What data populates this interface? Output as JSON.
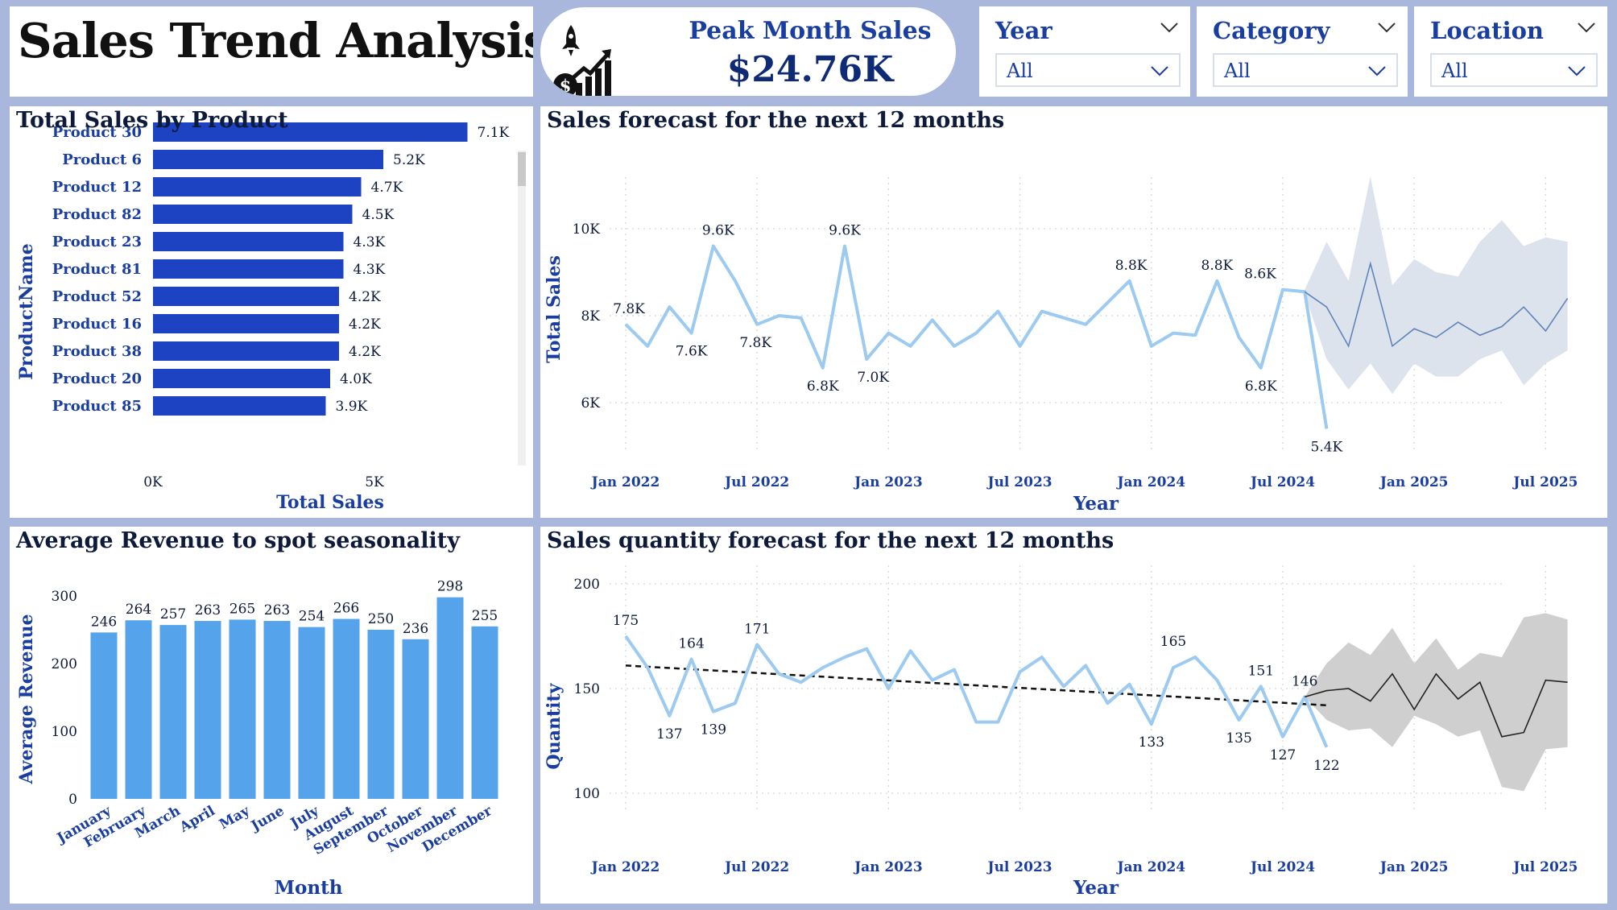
{
  "header": {
    "title": "Sales Trend Analysis",
    "kpi": {
      "label": "Peak Month Sales",
      "value": "$24.76K",
      "icon": "rocket-growth-chart-icon"
    }
  },
  "slicers": [
    {
      "title": "Year",
      "value": "All"
    },
    {
      "title": "Category",
      "value": "All"
    },
    {
      "title": "Location",
      "value": "All"
    }
  ],
  "colors": {
    "dark_bar": "#1d43c2",
    "light_bar": "#55a3ea",
    "line": "#9ccaf0",
    "forecast_band": "#dde3ec",
    "quantity_band": "#cfcfcf",
    "title_blue": "#1a3ea0",
    "background": "#a9b7dc"
  },
  "panels": {
    "products": {
      "title": "Total Sales by Product"
    },
    "forecast": {
      "title": "Sales forecast for the next 12 months"
    },
    "seasonal": {
      "title": "Average Revenue to spot seasonality"
    },
    "quantity": {
      "title": "Sales quantity forecast for the next 12 months"
    }
  },
  "chart_data": [
    {
      "id": "products",
      "type": "bar",
      "orientation": "horizontal",
      "xlabel": "Total Sales",
      "ylabel": "ProductName",
      "xlim": [
        0,
        7500
      ],
      "x_ticks": [
        "0K",
        "5K"
      ],
      "categories": [
        "Product 30",
        "Product 6",
        "Product 12",
        "Product 82",
        "Product 23",
        "Product 81",
        "Product 52",
        "Product 16",
        "Product 38",
        "Product 20",
        "Product 85"
      ],
      "values": [
        7100,
        5200,
        4700,
        4500,
        4300,
        4300,
        4200,
        4200,
        4200,
        4000,
        3900
      ],
      "labels": [
        "7.1K",
        "5.2K",
        "4.7K",
        "4.5K",
        "4.3K",
        "4.3K",
        "4.2K",
        "4.2K",
        "4.2K",
        "4.0K",
        "3.9K"
      ]
    },
    {
      "id": "forecast",
      "type": "line",
      "xlabel": "Year",
      "ylabel": "Total Sales",
      "ylim": [
        5000,
        11000
      ],
      "y_ticks": [
        {
          "value": 6000,
          "label": "6K"
        },
        {
          "value": 8000,
          "label": "8K"
        },
        {
          "value": 10000,
          "label": "10K"
        }
      ],
      "x_ticks": [
        "Jan 2022",
        "Jul 2022",
        "Jan 2023",
        "Jul 2023",
        "Jan 2024",
        "Jul 2024",
        "Jan 2025",
        "Jul 2025"
      ],
      "x_start": "Jan 2022",
      "series": [
        {
          "values": [
            7800,
            7300,
            8200,
            7600,
            9600,
            8800,
            7800,
            8000,
            7950,
            6800,
            9600,
            7000,
            7600,
            7300,
            7900,
            7300,
            7600,
            8100,
            7300,
            8100,
            7950,
            7800,
            8300,
            8800,
            7300,
            7600,
            7550,
            8800,
            7500,
            6800,
            8600,
            8550,
            5400
          ]
        },
        {
          "values": [
            8200,
            7300,
            9200,
            7300,
            7700,
            7500,
            7850,
            7550,
            7750,
            8200,
            7650,
            8400
          ]
        }
      ],
      "forecast_start": "Jul 2024",
      "forecast_lower": [
        8500,
        7000,
        6300,
        6900,
        6200,
        6900,
        6600,
        6600,
        7000,
        7200,
        6400,
        6900,
        7200
      ],
      "forecast_upper": [
        8600,
        9700,
        8800,
        11200,
        8700,
        9300,
        9000,
        8900,
        9700,
        10200,
        9600,
        9800,
        9700
      ],
      "point_labels": [
        {
          "value": 7800,
          "label": "7.8K",
          "pos": "above"
        },
        {
          "value": 7600,
          "label": "7.6K",
          "pos": "below"
        },
        {
          "value": 9600,
          "label": "9.6K",
          "pos": "above"
        },
        {
          "value": 7800,
          "label": "7.8K",
          "pos": "below"
        },
        {
          "value": 6800,
          "label": "6.8K",
          "pos": "below"
        },
        {
          "value": 9600,
          "label": "9.6K",
          "pos": "above"
        },
        {
          "value": 7000,
          "label": "7.0K",
          "pos": "below"
        },
        {
          "value": 8800,
          "label": "8.8K",
          "pos": "above"
        },
        {
          "value": 8800,
          "label": "8.8K",
          "pos": "above"
        },
        {
          "value": 6800,
          "label": "6.8K",
          "pos": "below"
        },
        {
          "value": 8600,
          "label": "8.6K",
          "pos": "above"
        },
        {
          "value": 5400,
          "label": "5.4K",
          "pos": "below"
        }
      ]
    },
    {
      "id": "seasonal",
      "type": "bar",
      "xlabel": "Month",
      "ylabel": "Average Revenue",
      "ylim": [
        0,
        300
      ],
      "y_ticks": [
        0,
        100,
        200,
        300
      ],
      "categories": [
        "January",
        "February",
        "March",
        "April",
        "May",
        "June",
        "July",
        "August",
        "September",
        "October",
        "November",
        "December"
      ],
      "values": [
        246,
        264,
        257,
        263,
        265,
        263,
        254,
        266,
        250,
        236,
        298,
        255
      ]
    },
    {
      "id": "quantity",
      "type": "line",
      "xlabel": "Year",
      "ylabel": "Quantity",
      "ylim": [
        95,
        205
      ],
      "y_ticks": [
        100,
        150,
        200
      ],
      "x_ticks": [
        "Jan 2022",
        "Jul 2022",
        "Jan 2023",
        "Jul 2023",
        "Jan 2024",
        "Jul 2024",
        "Jan 2025",
        "Jul 2025"
      ],
      "x_start": "Jan 2022",
      "series": [
        {
          "values": [
            175,
            160,
            137,
            164,
            139,
            143,
            171,
            157,
            153,
            160,
            165,
            169,
            150,
            168,
            154,
            159,
            134,
            134,
            158,
            165,
            151,
            161,
            143,
            152,
            133,
            160,
            165,
            154,
            135,
            151,
            127,
            146,
            122
          ]
        },
        {
          "values": [
            149,
            150,
            144,
            157,
            140,
            157,
            145,
            153,
            127,
            129,
            154,
            153
          ]
        }
      ],
      "trend": [
        161,
        142
      ],
      "forecast_start": "Jul 2024",
      "forecast_lower": [
        146,
        135,
        130,
        131,
        122,
        137,
        133,
        127,
        130,
        103,
        101,
        121,
        122
      ],
      "forecast_upper": [
        146,
        162,
        172,
        166,
        179,
        162,
        174,
        159,
        167,
        165,
        184,
        186,
        183
      ],
      "point_labels": [
        {
          "value": 175,
          "label": "175",
          "pos": "above"
        },
        {
          "value": 137,
          "label": "137",
          "pos": "below"
        },
        {
          "value": 164,
          "label": "164",
          "pos": "above"
        },
        {
          "value": 139,
          "label": "139",
          "pos": "below"
        },
        {
          "value": 171,
          "label": "171",
          "pos": "above"
        },
        {
          "value": 133,
          "label": "133",
          "pos": "below"
        },
        {
          "value": 165,
          "label": "165",
          "pos": "above"
        },
        {
          "value": 135,
          "label": "135",
          "pos": "below"
        },
        {
          "value": 151,
          "label": "151",
          "pos": "above"
        },
        {
          "value": 127,
          "label": "127",
          "pos": "below"
        },
        {
          "value": 146,
          "label": "146",
          "pos": "above"
        },
        {
          "value": 122,
          "label": "122",
          "pos": "below"
        }
      ]
    }
  ]
}
